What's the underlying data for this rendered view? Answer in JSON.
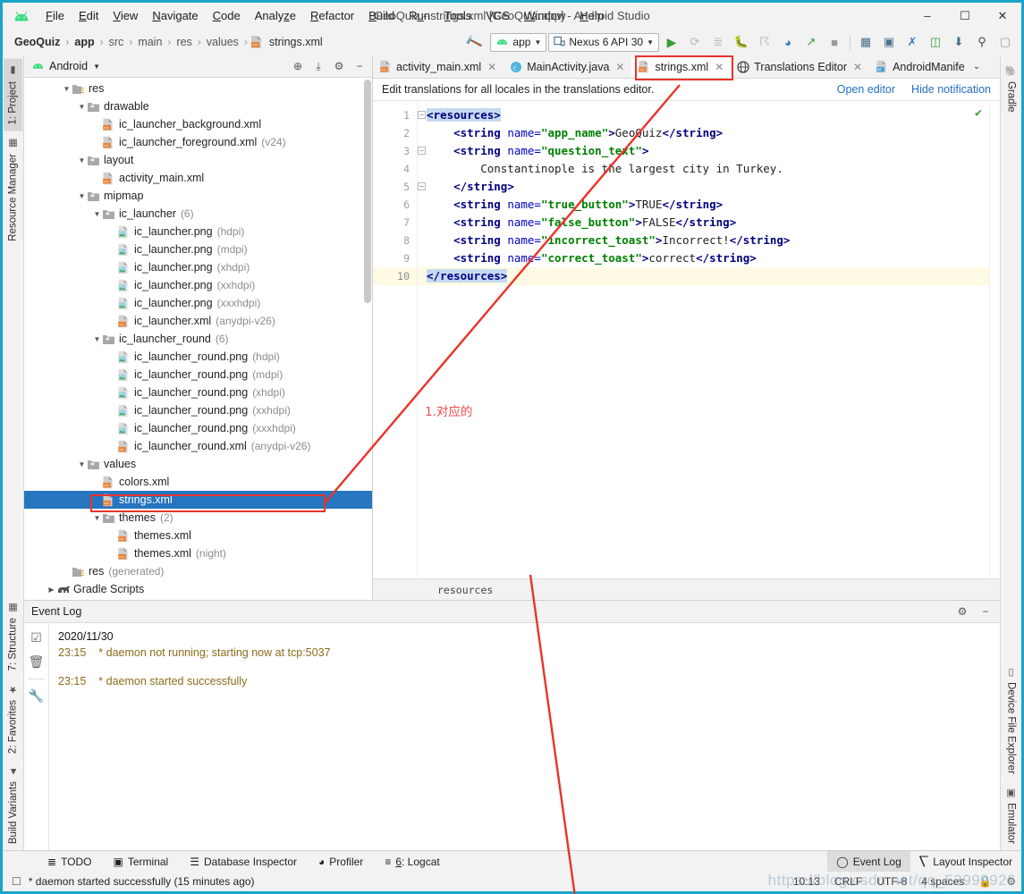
{
  "window": {
    "title": "GeoQuiz - strings.xml [GeoQuiz.app] - Android Studio",
    "minimize": "–",
    "maximize": "☐",
    "close": "✕"
  },
  "menubar": [
    {
      "label": "File"
    },
    {
      "label": "Edit"
    },
    {
      "label": "View"
    },
    {
      "label": "Navigate"
    },
    {
      "label": "Code"
    },
    {
      "label": "Analyze"
    },
    {
      "label": "Refactor"
    },
    {
      "label": "Build"
    },
    {
      "label": "Run"
    },
    {
      "label": "Tools"
    },
    {
      "label": "VCS"
    },
    {
      "label": "Window"
    },
    {
      "label": "Help"
    }
  ],
  "navbar": {
    "breadcrumbs": [
      "GeoQuiz",
      "app",
      "src",
      "main",
      "res",
      "values",
      "strings.xml"
    ],
    "separator": "›",
    "build_icon": "hammer-icon",
    "run_config": "app",
    "device": "Nexus 6 API 30",
    "actions": [
      {
        "name": "run-icon",
        "glyph": "▶"
      },
      {
        "name": "apply-changes-icon",
        "glyph": "⟳"
      },
      {
        "name": "apply-code-changes-icon",
        "glyph": "≣"
      },
      {
        "name": "debug-icon",
        "glyph": "⁂"
      },
      {
        "name": "attach-debugger-icon",
        "glyph": "⎇"
      },
      {
        "name": "profiler-icon",
        "glyph": "◔"
      },
      {
        "name": "run-with-coverage-icon",
        "glyph": "↯"
      },
      {
        "name": "stop-icon",
        "glyph": "■"
      }
    ],
    "actions2": [
      {
        "name": "sdk-manager-icon",
        "glyph": "▦"
      },
      {
        "name": "avd-manager-icon",
        "glyph": "◱"
      },
      {
        "name": "layout-inspector-icon",
        "glyph": "✇"
      },
      {
        "name": "device-manager-icon",
        "glyph": "▣"
      },
      {
        "name": "sync-gradle-icon",
        "glyph": "⬇"
      },
      {
        "name": "search-everywhere-icon",
        "glyph": "⌕"
      },
      {
        "name": "profile-icon",
        "glyph": "▯"
      }
    ]
  },
  "left_rail": {
    "top": [
      {
        "label": "1: Project",
        "icon": "project-icon",
        "selected": true
      },
      {
        "label": "Resource Manager",
        "icon": "resource-manager-icon",
        "selected": false
      }
    ],
    "bottom": [
      {
        "label": "7: Structure",
        "icon": "structure-icon"
      },
      {
        "label": "2: Favorites",
        "icon": "star-icon"
      },
      {
        "label": "Build Variants",
        "icon": "android-icon"
      }
    ]
  },
  "right_rail": {
    "top": [
      {
        "label": "Gradle",
        "icon": "gradle-elephant-icon"
      }
    ],
    "bottom": [
      {
        "label": "Device File Explorer",
        "icon": "device-icon"
      },
      {
        "label": "Emulator",
        "icon": "emulator-icon"
      }
    ]
  },
  "project_panel": {
    "title": "Android",
    "caret": "▾",
    "header_icons": [
      {
        "name": "target-icon",
        "glyph": "⊕"
      },
      {
        "name": "collapse-all-icon",
        "glyph": "⤓"
      },
      {
        "name": "settings-gear-icon",
        "glyph": "⚙"
      },
      {
        "name": "hide-panel-icon",
        "glyph": "−"
      }
    ],
    "tree": [
      {
        "indent": 2,
        "arrow": "▼",
        "icon": "folder-res-icon",
        "name": "res",
        "qualifier": ""
      },
      {
        "indent": 3,
        "arrow": "▼",
        "icon": "folder-icon",
        "name": "drawable",
        "qualifier": ""
      },
      {
        "indent": 4,
        "arrow": "",
        "icon": "xml-file-icon",
        "name": "ic_launcher_background.xml",
        "qualifier": ""
      },
      {
        "indent": 4,
        "arrow": "",
        "icon": "xml-file-icon",
        "name": "ic_launcher_foreground.xml",
        "qualifier": "(v24)"
      },
      {
        "indent": 3,
        "arrow": "▼",
        "icon": "folder-icon",
        "name": "layout",
        "qualifier": ""
      },
      {
        "indent": 4,
        "arrow": "",
        "icon": "xml-file-icon",
        "name": "activity_main.xml",
        "qualifier": ""
      },
      {
        "indent": 3,
        "arrow": "▼",
        "icon": "folder-icon",
        "name": "mipmap",
        "qualifier": ""
      },
      {
        "indent": 4,
        "arrow": "▼",
        "icon": "folder-icon",
        "name": "ic_launcher",
        "qualifier": "(6)"
      },
      {
        "indent": 5,
        "arrow": "",
        "icon": "png-file-icon",
        "name": "ic_launcher.png",
        "qualifier": "(hdpi)"
      },
      {
        "indent": 5,
        "arrow": "",
        "icon": "png-file-icon",
        "name": "ic_launcher.png",
        "qualifier": "(mdpi)"
      },
      {
        "indent": 5,
        "arrow": "",
        "icon": "png-file-icon",
        "name": "ic_launcher.png",
        "qualifier": "(xhdpi)"
      },
      {
        "indent": 5,
        "arrow": "",
        "icon": "png-file-icon",
        "name": "ic_launcher.png",
        "qualifier": "(xxhdpi)"
      },
      {
        "indent": 5,
        "arrow": "",
        "icon": "png-file-icon",
        "name": "ic_launcher.png",
        "qualifier": "(xxxhdpi)"
      },
      {
        "indent": 5,
        "arrow": "",
        "icon": "xml-file-icon",
        "name": "ic_launcher.xml",
        "qualifier": "(anydpi-v26)"
      },
      {
        "indent": 4,
        "arrow": "▼",
        "icon": "folder-icon",
        "name": "ic_launcher_round",
        "qualifier": "(6)"
      },
      {
        "indent": 5,
        "arrow": "",
        "icon": "png-file-icon",
        "name": "ic_launcher_round.png",
        "qualifier": "(hdpi)"
      },
      {
        "indent": 5,
        "arrow": "",
        "icon": "png-file-icon",
        "name": "ic_launcher_round.png",
        "qualifier": "(mdpi)"
      },
      {
        "indent": 5,
        "arrow": "",
        "icon": "png-file-icon",
        "name": "ic_launcher_round.png",
        "qualifier": "(xhdpi)"
      },
      {
        "indent": 5,
        "arrow": "",
        "icon": "png-file-icon",
        "name": "ic_launcher_round.png",
        "qualifier": "(xxhdpi)"
      },
      {
        "indent": 5,
        "arrow": "",
        "icon": "png-file-icon",
        "name": "ic_launcher_round.png",
        "qualifier": "(xxxhdpi)"
      },
      {
        "indent": 5,
        "arrow": "",
        "icon": "xml-file-icon",
        "name": "ic_launcher_round.xml",
        "qualifier": "(anydpi-v26)"
      },
      {
        "indent": 3,
        "arrow": "▼",
        "icon": "folder-icon",
        "name": "values",
        "qualifier": ""
      },
      {
        "indent": 4,
        "arrow": "",
        "icon": "xml-file-icon",
        "name": "colors.xml",
        "qualifier": ""
      },
      {
        "indent": 4,
        "arrow": "",
        "icon": "xml-file-icon",
        "name": "strings.xml",
        "qualifier": "",
        "selected": true,
        "highlighted": true
      },
      {
        "indent": 4,
        "arrow": "▼",
        "icon": "folder-icon",
        "name": "themes",
        "qualifier": "(2)"
      },
      {
        "indent": 5,
        "arrow": "",
        "icon": "xml-file-icon",
        "name": "themes.xml",
        "qualifier": ""
      },
      {
        "indent": 5,
        "arrow": "",
        "icon": "xml-file-icon",
        "name": "themes.xml",
        "qualifier": "(night)"
      },
      {
        "indent": 2,
        "arrow": "",
        "icon": "folder-res-icon",
        "name": "res",
        "qualifier": "(generated)"
      },
      {
        "indent": 1,
        "arrow": "▶",
        "icon": "gradle-elephant-icon",
        "name": "Gradle Scripts",
        "qualifier": ""
      }
    ]
  },
  "editor": {
    "tabs": [
      {
        "label": "activity_main.xml",
        "icon": "xml-file-icon",
        "active": false,
        "closable": true
      },
      {
        "label": "MainActivity.java",
        "icon": "java-class-icon",
        "active": false,
        "closable": true
      },
      {
        "label": "strings.xml",
        "icon": "xml-file-icon",
        "active": true,
        "closable": true,
        "highlighted": true
      },
      {
        "label": "Translations Editor",
        "icon": "globe-icon",
        "active": false,
        "closable": true
      },
      {
        "label": "AndroidManife",
        "icon": "manifest-file-icon",
        "active": false,
        "closable": false
      }
    ],
    "tabs_overflow": "⌄",
    "notification": {
      "message": "Edit translations for all locales in the translations editor.",
      "open_editor": "Open editor",
      "hide_notification": "Hide notification"
    },
    "lines": [
      {
        "n": 1,
        "fold": "−",
        "current": false,
        "segments": [
          {
            "t": "<resources>",
            "c": "tagname",
            "hl": true
          }
        ]
      },
      {
        "n": 2,
        "fold": "",
        "current": false,
        "segments": [
          {
            "t": "    ",
            "c": "txt"
          },
          {
            "t": "<string ",
            "c": "tagname"
          },
          {
            "t": "name=",
            "c": "attr"
          },
          {
            "t": "\"app_name\"",
            "c": "aval"
          },
          {
            "t": ">",
            "c": "tagname"
          },
          {
            "t": "GeoQuiz",
            "c": "txt"
          },
          {
            "t": "</string>",
            "c": "tagname"
          }
        ]
      },
      {
        "n": 3,
        "fold": "−",
        "current": false,
        "segments": [
          {
            "t": "    ",
            "c": "txt"
          },
          {
            "t": "<string ",
            "c": "tagname"
          },
          {
            "t": "name=",
            "c": "attr"
          },
          {
            "t": "\"question_text\"",
            "c": "aval"
          },
          {
            "t": ">",
            "c": "tagname"
          }
        ]
      },
      {
        "n": 4,
        "fold": "",
        "current": false,
        "segments": [
          {
            "t": "        Constantinople is the largest city in Turkey.",
            "c": "txt"
          }
        ]
      },
      {
        "n": 5,
        "fold": "−",
        "current": false,
        "segments": [
          {
            "t": "    ",
            "c": "txt"
          },
          {
            "t": "</string>",
            "c": "tagname"
          }
        ]
      },
      {
        "n": 6,
        "fold": "",
        "current": false,
        "segments": [
          {
            "t": "    ",
            "c": "txt"
          },
          {
            "t": "<string ",
            "c": "tagname"
          },
          {
            "t": "name=",
            "c": "attr"
          },
          {
            "t": "\"true_button\"",
            "c": "aval"
          },
          {
            "t": ">",
            "c": "tagname"
          },
          {
            "t": "TRUE",
            "c": "txt"
          },
          {
            "t": "</string>",
            "c": "tagname"
          }
        ]
      },
      {
        "n": 7,
        "fold": "",
        "current": false,
        "segments": [
          {
            "t": "    ",
            "c": "txt"
          },
          {
            "t": "<string ",
            "c": "tagname"
          },
          {
            "t": "name=",
            "c": "attr"
          },
          {
            "t": "\"false_button\"",
            "c": "aval"
          },
          {
            "t": ">",
            "c": "tagname"
          },
          {
            "t": "FALSE",
            "c": "txt"
          },
          {
            "t": "</string>",
            "c": "tagname"
          }
        ]
      },
      {
        "n": 8,
        "fold": "",
        "current": false,
        "segments": [
          {
            "t": "    ",
            "c": "txt"
          },
          {
            "t": "<string ",
            "c": "tagname"
          },
          {
            "t": "name=",
            "c": "attr"
          },
          {
            "t": "\"incorrect_toast\"",
            "c": "aval"
          },
          {
            "t": ">",
            "c": "tagname"
          },
          {
            "t": "Incorrect!",
            "c": "txt"
          },
          {
            "t": "</string>",
            "c": "tagname"
          }
        ]
      },
      {
        "n": 9,
        "fold": "",
        "current": false,
        "bulb": true,
        "segments": [
          {
            "t": "    ",
            "c": "txt"
          },
          {
            "t": "<string ",
            "c": "tagname"
          },
          {
            "t": "name=",
            "c": "attr"
          },
          {
            "t": "\"correct_toast\"",
            "c": "aval"
          },
          {
            "t": ">",
            "c": "tagname"
          },
          {
            "t": "correct",
            "c": "txt"
          },
          {
            "t": "</string>",
            "c": "tagname"
          }
        ]
      },
      {
        "n": 10,
        "fold": "−",
        "current": true,
        "segments": [
          {
            "t": "</resources>",
            "c": "tagname",
            "hl": true
          }
        ]
      }
    ],
    "inspection_ok": "✔",
    "breadcrumb_bottom": "resources",
    "annotation": "1.对应的"
  },
  "event_log": {
    "title": "Event Log",
    "header_icons": [
      {
        "name": "settings-gear-icon",
        "glyph": "⚙"
      },
      {
        "name": "hide-panel-icon",
        "glyph": "−"
      }
    ],
    "rail_icons": [
      {
        "name": "mark-all-read-icon",
        "glyph": "☑"
      },
      {
        "name": "delete-icon",
        "glyph": "🗑"
      },
      {
        "name": "settings-wrench-icon",
        "glyph": "🔧"
      }
    ],
    "date": "2020/11/30",
    "entries": [
      {
        "time": "23:15",
        "message": "* daemon not running; starting now at tcp:5037"
      },
      {
        "time": "23:15",
        "message": "* daemon started successfully"
      }
    ]
  },
  "bottom_tools": {
    "left": [
      {
        "label": "TODO",
        "icon": "todo-icon",
        "glyph": "≡"
      },
      {
        "label": "Terminal",
        "icon": "terminal-icon",
        "glyph": "▣"
      },
      {
        "label": "Database Inspector",
        "icon": "database-icon",
        "glyph": "⌸"
      },
      {
        "label": "Profiler",
        "icon": "profiler-icon",
        "glyph": "◔"
      },
      {
        "label": "6: Logcat",
        "icon": "logcat-icon",
        "glyph": "≡"
      }
    ],
    "right": [
      {
        "label": "Event Log",
        "icon": "event-log-icon",
        "glyph": "◯",
        "selected": true
      },
      {
        "label": "Layout Inspector",
        "icon": "layout-inspector-icon",
        "glyph": "❐",
        "selected": false
      }
    ]
  },
  "statusbar": {
    "message": "* daemon started successfully (15 minutes ago)",
    "icon": "notification-icon",
    "caret_position": "10:13",
    "line_separator": "CRLF",
    "encoding": "UTF-8",
    "indent": "4 spaces",
    "lock_icon": "🔒",
    "inspection_icon": "☑",
    "watermark": "https://blog.csdn.net/qq_53999926"
  },
  "colors": {
    "accent_blue": "#2675bf",
    "annotation_red": "#e8342b",
    "tag_navy": "#000080",
    "attr_value_green": "#008000",
    "link_blue": "#2470c4",
    "log_amber": "#8a6d1b",
    "android_green": "#3ddc84",
    "border_cyan": "#1aa4c8"
  }
}
